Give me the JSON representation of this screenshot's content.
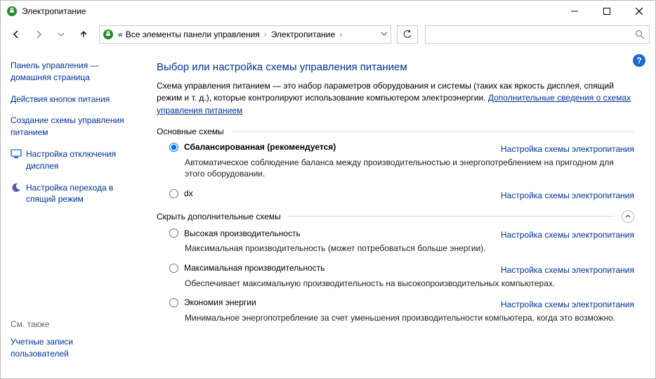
{
  "window": {
    "title": "Электропитание"
  },
  "breadcrumb": {
    "sep": "«",
    "item1": "Все элементы панели управления",
    "item2": "Электропитание"
  },
  "help_glyph": "?",
  "sidebar": {
    "home": "Панель управления — домашняя страница",
    "links": [
      "Действия кнопок питания",
      "Создание схемы управления питанием",
      "Настройка отключения дисплея",
      "Настройка перехода в спящий режим"
    ],
    "see_also": "См. также",
    "accounts": "Учетные записи пользователей"
  },
  "main": {
    "heading": "Выбор или настройка схемы управления питанием",
    "intro_text": "Схема управления питанием — это набор параметров оборудования и системы (таких как яркость дисплея, спящий режим и т. д.), которые контролируют использование компьютером электроэнергии. ",
    "intro_link": "Дополнительные сведения о схемах управления питанием",
    "section_primary": "Основные схемы",
    "section_extra": "Скрыть дополнительные схемы",
    "config_link": "Настройка схемы электропитания",
    "plans_primary": [
      {
        "name": "Сбалансированная (рекомендуется)",
        "desc": "Автоматическое соблюдение баланса между производительностью и энергопотреблением на пригодном для этого оборудовании.",
        "checked": true,
        "bold": true
      },
      {
        "name": "dx",
        "desc": "",
        "checked": false,
        "bold": false
      }
    ],
    "plans_extra": [
      {
        "name": "Высокая производительность",
        "desc": "Максимальная производительность (может потребоваться больше энергии)."
      },
      {
        "name": "Максимальная производительность",
        "desc": "Обеспечивает максимальную производительность на высокопроизводительных компьютерах."
      },
      {
        "name": "Экономия энергии",
        "desc": "Минимальное энергопотребление за счет уменьшения производительности компьютера, когда это возможно."
      }
    ]
  }
}
